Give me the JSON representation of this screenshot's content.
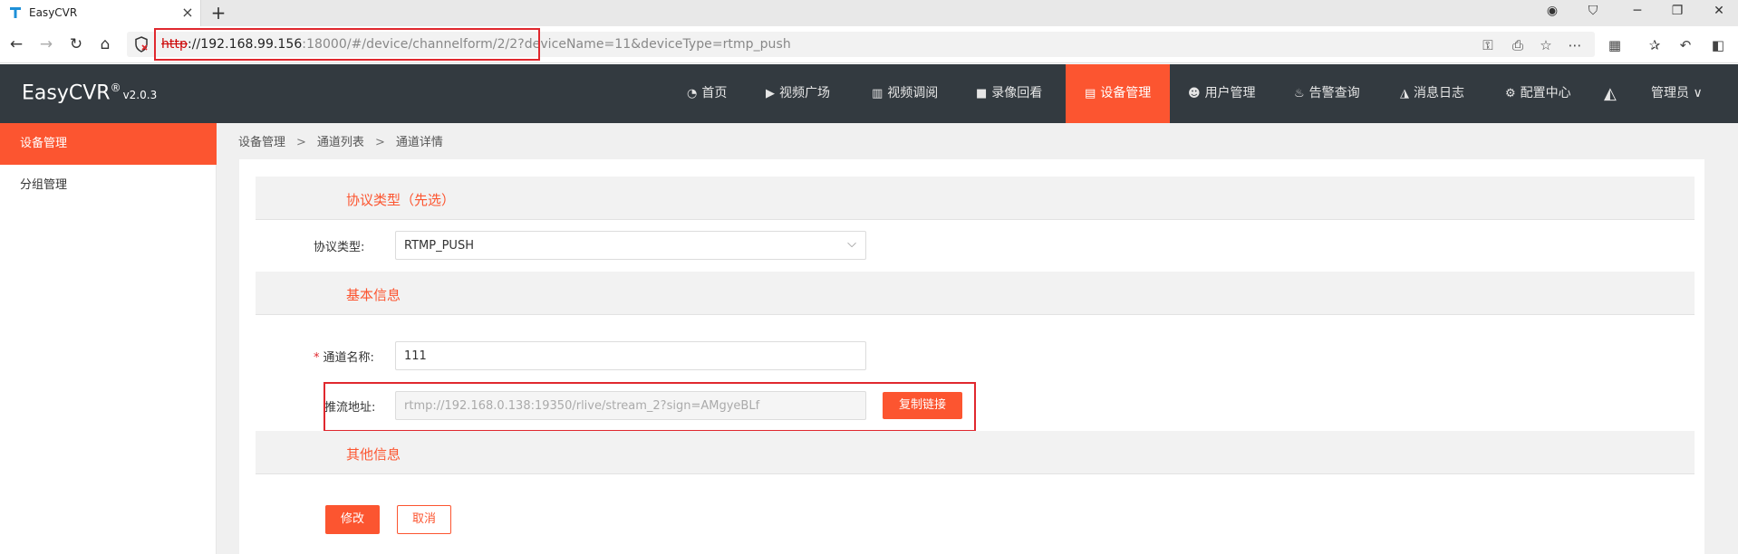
{
  "browser": {
    "tab_title": "EasyCVR",
    "tab_close": "×",
    "new_tab": "+",
    "url_proto": "http",
    "url_host": "://192.168.99.156",
    "url_rest": ":18000/#/device/channelform/2/2?deviceName=11&deviceType=rtmp_push"
  },
  "app": {
    "logo": "EasyCVR",
    "logo_mark": "®",
    "version": "v2.0.3",
    "nav": [
      {
        "label": "首页",
        "icon": "dashboard-icon"
      },
      {
        "label": "视频广场",
        "icon": "play-icon"
      },
      {
        "label": "视频调阅",
        "icon": "grid-icon"
      },
      {
        "label": "录像回看",
        "icon": "video-camera-icon"
      },
      {
        "label": "设备管理",
        "icon": "device-icon"
      },
      {
        "label": "用户管理",
        "icon": "user-icon"
      },
      {
        "label": "告警查询",
        "icon": "alarm-icon"
      },
      {
        "label": "消息日志",
        "icon": "bell-icon"
      },
      {
        "label": "配置中心",
        "icon": "gear-icon"
      }
    ],
    "user": "管理员 ∨",
    "accent": "#fc5530"
  },
  "sidebar": {
    "items": [
      {
        "label": "设备管理"
      },
      {
        "label": "分组管理"
      }
    ]
  },
  "breadcrumb": [
    "设备管理",
    "通道列表",
    "通道详情"
  ],
  "breadcrumb_sep": ">",
  "form": {
    "section_protocol": "协议类型（先选）",
    "protocol_label": "协议类型:",
    "protocol_value": "RTMP_PUSH",
    "section_basic": "基本信息",
    "name_req": "*",
    "name_label": "通道名称:",
    "name_value": "111",
    "push_label": "推流地址:",
    "push_value": "rtmp://192.168.0.138:19350/rlive/stream_2?sign=AMgyeBLf",
    "copy_label": "复制链接",
    "section_other": "其他信息",
    "submit_label": "修改",
    "cancel_label": "取消"
  }
}
